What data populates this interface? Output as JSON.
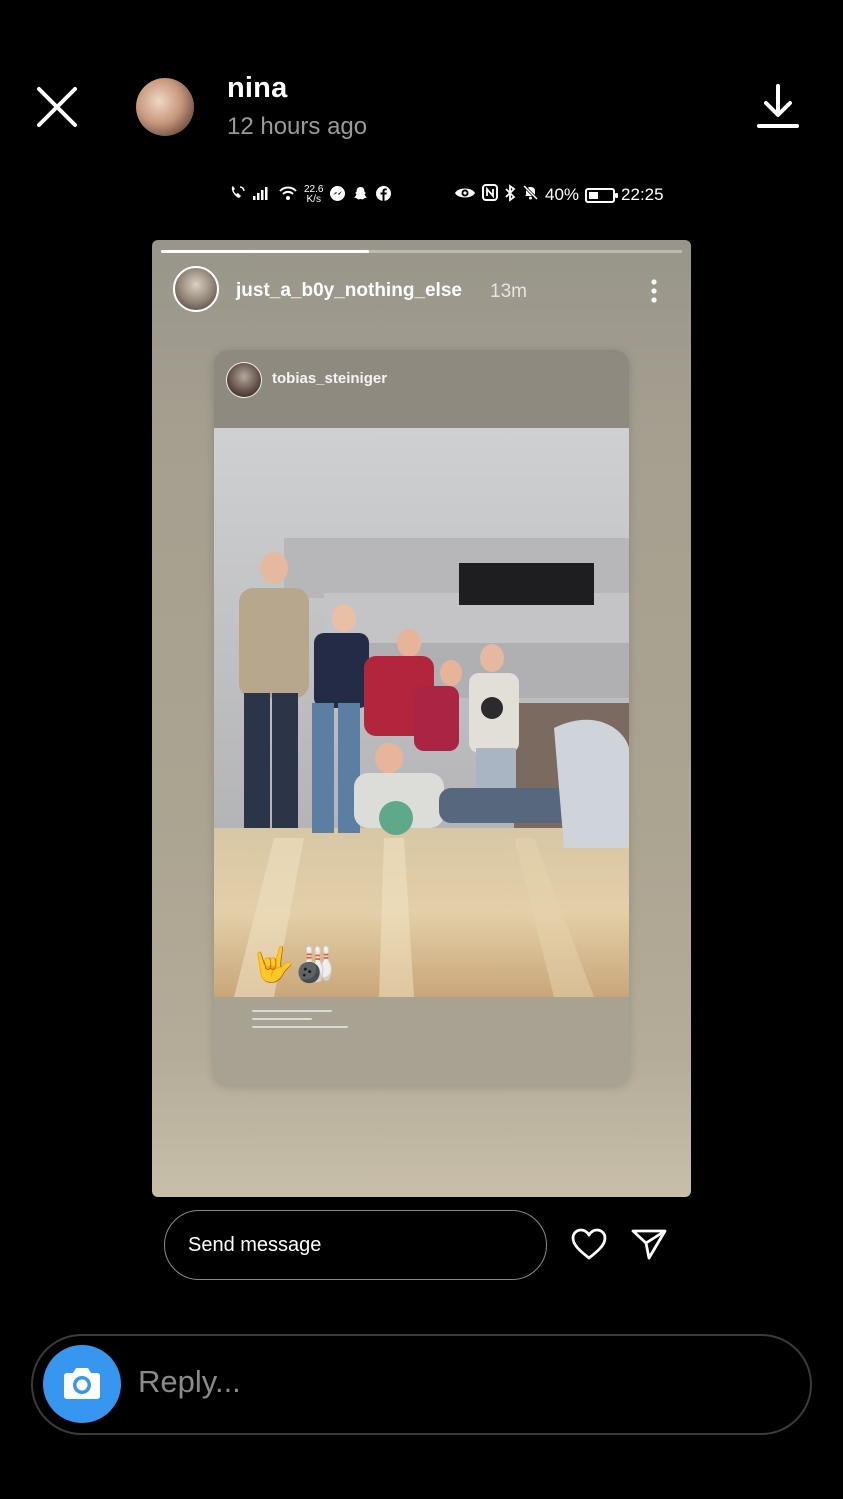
{
  "header": {
    "username": "nina",
    "timestamp": "12 hours ago",
    "icons": {
      "close": "close-icon",
      "download": "download-icon"
    }
  },
  "status_bar": {
    "speed_top": "22.6",
    "speed_bottom": "K/s",
    "battery": "40%",
    "battery_level": 0.4,
    "time": "22:25",
    "icons": [
      "phone-wifi-icon",
      "signal-icon",
      "wifi-icon",
      "messenger-icon",
      "snapchat-icon",
      "facebook-icon",
      "eye-icon",
      "nfc-icon",
      "bluetooth-icon",
      "mute-icon",
      "battery-icon"
    ]
  },
  "story": {
    "progress": 0.4,
    "username": "just_a_b0y_nothing_else",
    "time": "13m",
    "shared_post": {
      "username": "tobias_steiniger",
      "sticker": "🤟🎳"
    }
  },
  "actions": {
    "send_message_label": "Send message",
    "icons": {
      "like": "heart-icon",
      "share": "send-icon"
    }
  },
  "reply": {
    "placeholder": "Reply...",
    "camera_icon": "camera-icon",
    "accent": "#3797f0"
  }
}
